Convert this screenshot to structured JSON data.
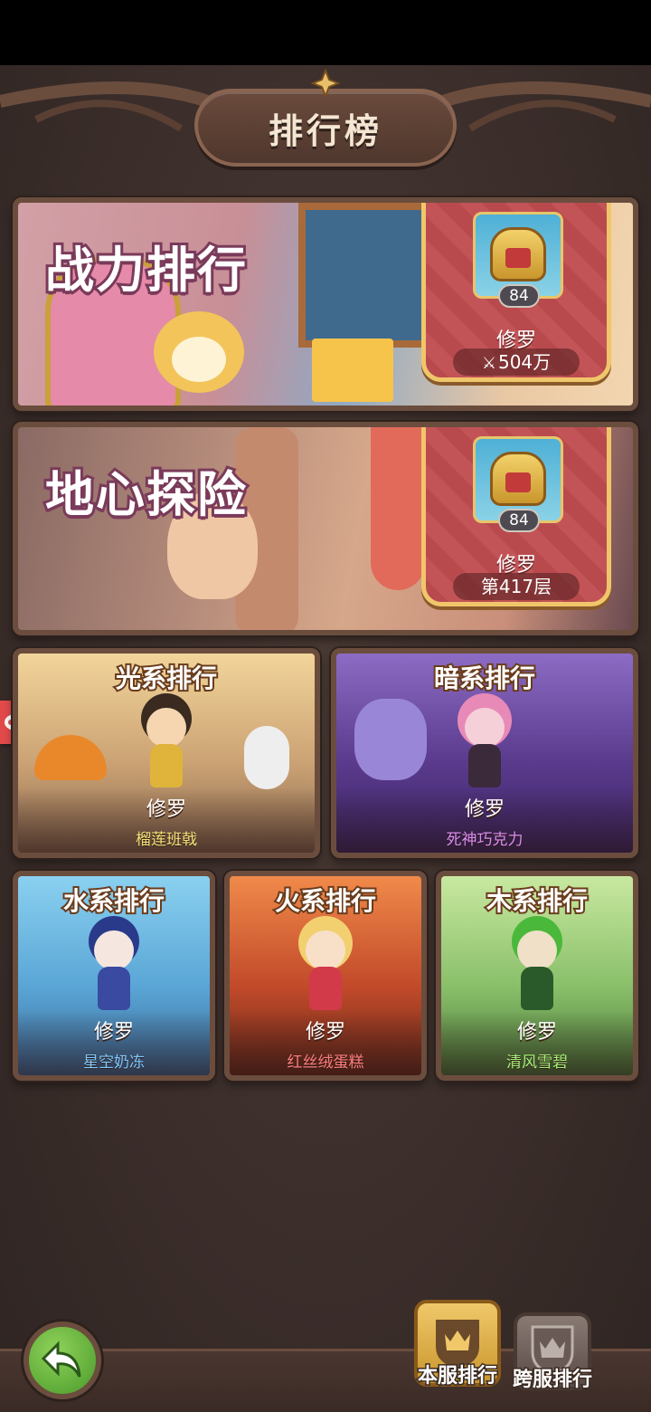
{
  "header": {
    "title": "排行榜"
  },
  "power_rank": {
    "title": "战力排行",
    "level": "84",
    "player": "修罗",
    "value": "504万"
  },
  "depth_rank": {
    "title": "地心探险",
    "level": "84",
    "player": "修罗",
    "value": "第417层"
  },
  "element_ranks": {
    "light": {
      "title": "光系排行",
      "player": "修罗",
      "hero": "榴莲班戟",
      "hero_color": "#f6e27a"
    },
    "dark": {
      "title": "暗系排行",
      "player": "修罗",
      "hero": "死神巧克力",
      "hero_color": "#d98cf0"
    },
    "water": {
      "title": "水系排行",
      "player": "修罗",
      "hero": "星空奶冻",
      "hero_color": "#7fc8ff"
    },
    "fire": {
      "title": "火系排行",
      "player": "修罗",
      "hero": "红丝绒蛋糕",
      "hero_color": "#ff7e7e"
    },
    "wood": {
      "title": "木系排行",
      "player": "修罗",
      "hero": "清风雪碧",
      "hero_color": "#a6f07a"
    }
  },
  "bottom_tabs": {
    "local": "本服排行",
    "cross": "跨服排行"
  },
  "icons": {
    "back": "back-arrow-icon",
    "local_tab": "crown-shield-icon",
    "cross_tab": "crown-emblem-icon",
    "side": "gamepad-icon"
  }
}
